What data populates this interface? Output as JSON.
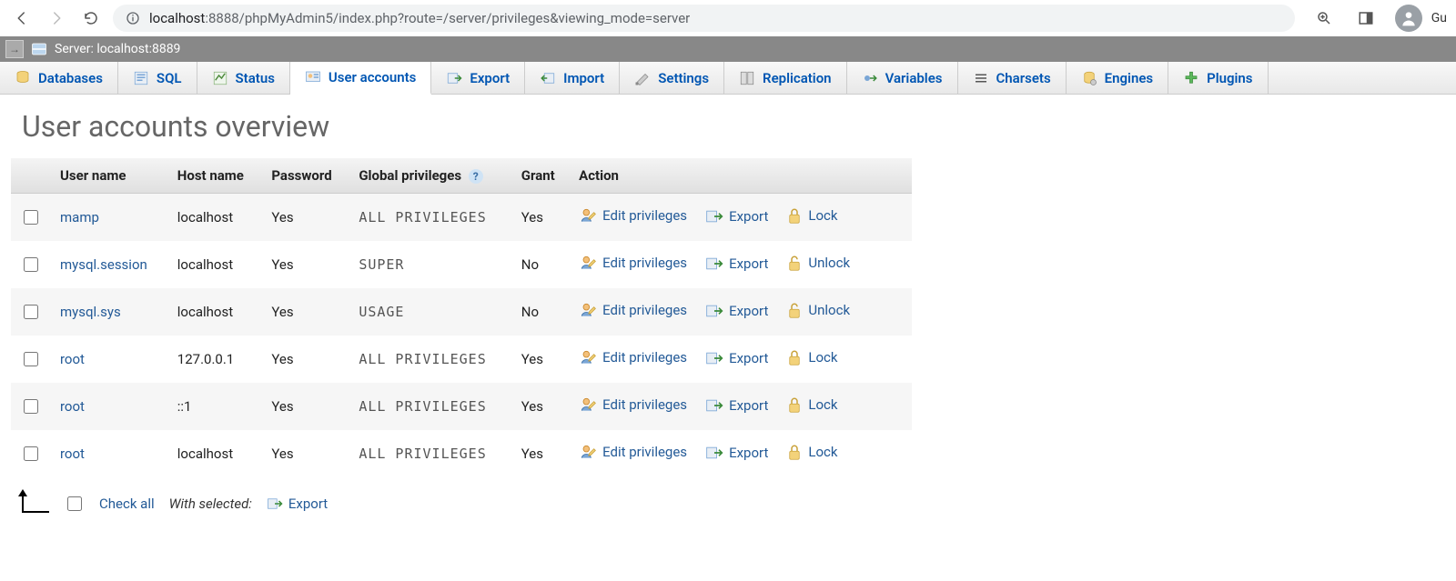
{
  "browser": {
    "url_prefix": "localhost",
    "url_rest": ":8888/phpMyAdmin5/index.php?route=/server/privileges&viewing_mode=server",
    "guest_initial": "Gu"
  },
  "server_bar": {
    "label": "Server: localhost:8889"
  },
  "tabs": [
    {
      "label": "Databases"
    },
    {
      "label": "SQL"
    },
    {
      "label": "Status"
    },
    {
      "label": "User accounts",
      "active": true
    },
    {
      "label": "Export"
    },
    {
      "label": "Import"
    },
    {
      "label": "Settings"
    },
    {
      "label": "Replication"
    },
    {
      "label": "Variables"
    },
    {
      "label": "Charsets"
    },
    {
      "label": "Engines"
    },
    {
      "label": "Plugins"
    }
  ],
  "page_title": "User accounts overview",
  "headers": {
    "user": "User name",
    "host": "Host name",
    "password": "Password",
    "privileges": "Global privileges",
    "grant": "Grant",
    "action": "Action"
  },
  "action_labels": {
    "edit": "Edit privileges",
    "export": "Export",
    "lock": "Lock",
    "unlock": "Unlock"
  },
  "users": [
    {
      "user": "mamp",
      "host": "localhost",
      "password": "Yes",
      "privileges": "ALL PRIVILEGES",
      "grant": "Yes",
      "lock_state": "Lock"
    },
    {
      "user": "mysql.session",
      "host": "localhost",
      "password": "Yes",
      "privileges": "SUPER",
      "grant": "No",
      "lock_state": "Unlock"
    },
    {
      "user": "mysql.sys",
      "host": "localhost",
      "password": "Yes",
      "privileges": "USAGE",
      "grant": "No",
      "lock_state": "Unlock"
    },
    {
      "user": "root",
      "host": "127.0.0.1",
      "password": "Yes",
      "privileges": "ALL PRIVILEGES",
      "grant": "Yes",
      "lock_state": "Lock"
    },
    {
      "user": "root",
      "host": "::1",
      "password": "Yes",
      "privileges": "ALL PRIVILEGES",
      "grant": "Yes",
      "lock_state": "Lock"
    },
    {
      "user": "root",
      "host": "localhost",
      "password": "Yes",
      "privileges": "ALL PRIVILEGES",
      "grant": "Yes",
      "lock_state": "Lock"
    }
  ],
  "footer": {
    "check_all": "Check all",
    "with_selected": "With selected:",
    "export": "Export"
  }
}
